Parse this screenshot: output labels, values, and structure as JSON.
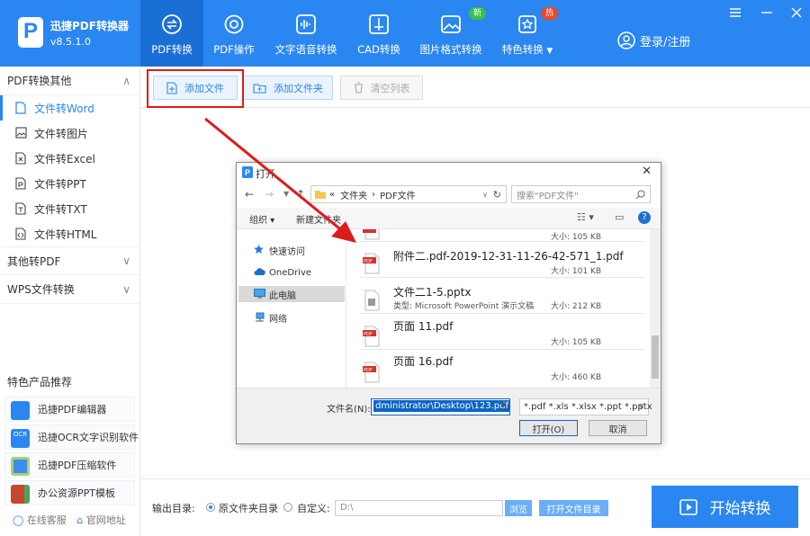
{
  "app": {
    "name": "迅捷PDF转换器",
    "version": "v8.5.1.0",
    "logo_letter": "P"
  },
  "tabs": [
    {
      "label": "PDF转换",
      "icon": "convert-icon",
      "active": true
    },
    {
      "label": "PDF操作",
      "icon": "gear-icon"
    },
    {
      "label": "文字语音转换",
      "icon": "audio-wave-icon"
    },
    {
      "label": "CAD转换",
      "icon": "cad-icon"
    },
    {
      "label": "图片格式转换",
      "icon": "image-icon",
      "badge": "新",
      "badge_color": "#3cc04a"
    },
    {
      "label": "特色转换",
      "icon": "star-box-icon",
      "badge": "热",
      "badge_color": "#f0452a",
      "caret": "▼"
    }
  ],
  "login": "登录/注册",
  "sidebar": {
    "sections": [
      {
        "label": "PDF转换其他",
        "arrow": "∧"
      },
      {
        "label": "其他转PDF",
        "arrow": "∨"
      },
      {
        "label": "WPS文件转换",
        "arrow": "∨"
      }
    ],
    "items": [
      {
        "label": "文件转Word"
      },
      {
        "label": "文件转图片"
      },
      {
        "label": "文件转Excel"
      },
      {
        "label": "文件转PPT"
      },
      {
        "label": "文件转TXT"
      },
      {
        "label": "文件转HTML"
      }
    ],
    "recommend_title": "特色产品推荐",
    "recommend": [
      {
        "label": "迅捷PDF编辑器",
        "icon_text": ""
      },
      {
        "label": "迅捷OCR文字识别软件",
        "icon_text": "OCR"
      },
      {
        "label": "迅捷PDF压缩软件",
        "icon_text": ""
      },
      {
        "label": "办公资源PPT模板",
        "icon_text": ""
      }
    ],
    "service": "在线客服",
    "website": "官网地址"
  },
  "toolbar": {
    "add_file": "添加文件",
    "add_folder": "添加文件夹",
    "clear": "清空列表"
  },
  "output": {
    "label": "输出目录:",
    "opt_source": "原文件夹目录",
    "opt_custom": "自定义:",
    "path": "D:\\",
    "browse": "浏览",
    "open_folder": "打开文件目录"
  },
  "start_button": "开始转换",
  "dialog": {
    "title": "打开",
    "breadcrumb": [
      "«",
      "文件夹",
      "PDF文件"
    ],
    "search_placeholder": "搜索\"PDF文件\"",
    "organize": "组织 ▾",
    "new_folder": "新建文件夹",
    "nav": [
      {
        "label": "快速访问"
      },
      {
        "label": "OneDrive"
      },
      {
        "label": "此电脑",
        "selected": true
      },
      {
        "label": "网络"
      }
    ],
    "files": [
      {
        "name": "",
        "type": "",
        "size": "大小: 105 KB",
        "kind": "pdf"
      },
      {
        "name": "附件二.pdf-2019-12-31-11-26-42-571_1.pdf",
        "type": "",
        "size": "大小: 101 KB",
        "kind": "pdf"
      },
      {
        "name": "文件二1-5.pptx",
        "type": "类型: Microsoft PowerPoint 演示文稿",
        "size": "大小: 212 KB",
        "kind": "pptx"
      },
      {
        "name": "页面 11.pdf",
        "type": "",
        "size": "大小: 105 KB",
        "kind": "pdf"
      },
      {
        "name": "页面 16.pdf",
        "type": "",
        "size": "大小: 460 KB",
        "kind": "pdf"
      }
    ],
    "filename_label": "文件名(N):",
    "filename_value": "dministrator\\Desktop\\123.pdf",
    "filetype": "*.pdf *.xls *.xlsx *.ppt *.pptx",
    "open": "打开(O)",
    "cancel": "取消"
  },
  "colors": {
    "brand": "#2a86f0",
    "highlight": "#e01a1a"
  }
}
